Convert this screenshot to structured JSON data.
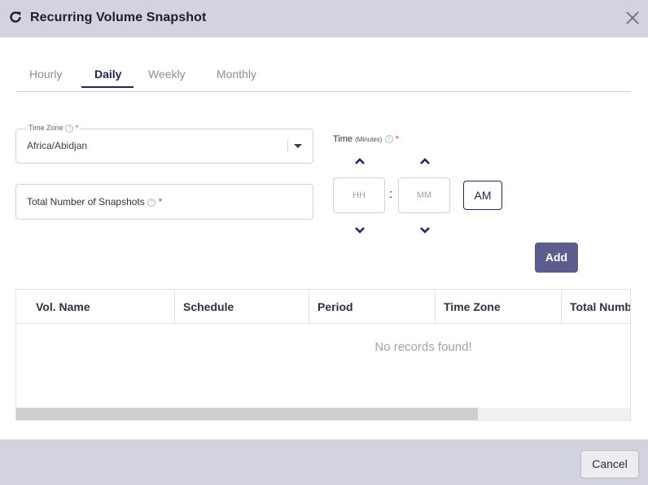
{
  "dialog": {
    "title": "Recurring Volume Snapshot",
    "refresh_icon": "refresh-icon",
    "close_icon": "close-icon"
  },
  "tabs": [
    {
      "label": "Hourly",
      "active": false
    },
    {
      "label": "Daily",
      "active": true
    },
    {
      "label": "Weekly",
      "active": false
    },
    {
      "label": "Monthly",
      "active": false
    }
  ],
  "form": {
    "time_zone": {
      "label": "Time Zone",
      "required_mark": "*",
      "value": "Africa/Abidjan",
      "help_icon": "help-icon"
    },
    "snapshots": {
      "label": "Total Number of Snapshots",
      "required_mark": "*",
      "help_icon": "help-icon"
    },
    "time": {
      "label": "Time",
      "unit": "(Minutes)",
      "required_mark": "*",
      "hour_placeholder": "HH",
      "minute_placeholder": "MM",
      "separator": ":",
      "period": "AM"
    },
    "add_label": "Add"
  },
  "table": {
    "columns": [
      "Vol. Name",
      "Schedule",
      "Period",
      "Time Zone",
      "Total Numb"
    ],
    "empty_message": "No records found!",
    "scroll_fraction": 0.75
  },
  "footer": {
    "cancel_label": "Cancel"
  },
  "colors": {
    "accent": "#23275a",
    "add_button": "#5b5e8c",
    "header_bg": "#d3d3e0",
    "required": "#d93b3b"
  }
}
